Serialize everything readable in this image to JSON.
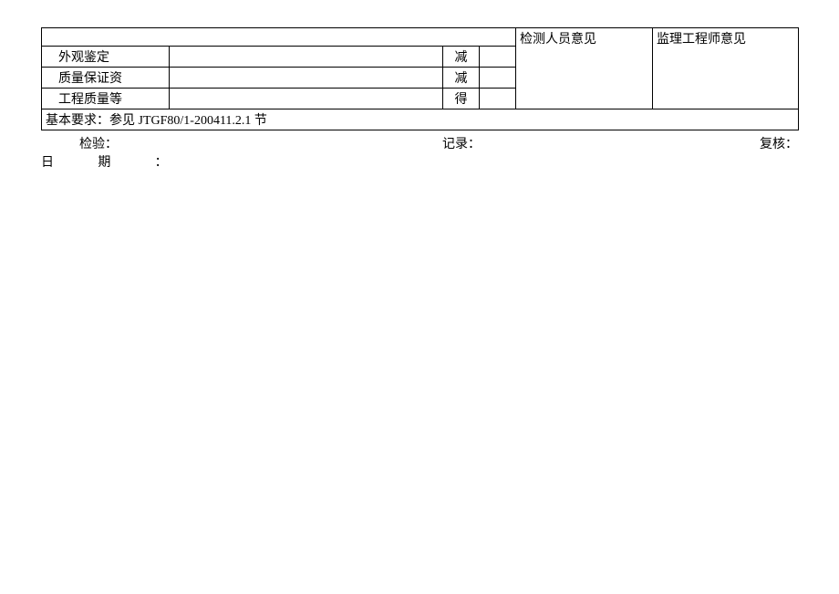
{
  "table": {
    "rows": [
      {
        "label": "外观鉴定",
        "short": "减"
      },
      {
        "label": "质量保证资",
        "short": "减"
      },
      {
        "label": "工程质量等",
        "short": "得"
      }
    ],
    "opinion1_header": "检测人员意见",
    "opinion2_header": "监理工程师意见",
    "basic_requirement": "基本要求：参见 JTGF80/1-200411.2.1 节"
  },
  "footer": {
    "inspect": "检验：",
    "record": "记录：",
    "review": "复核：",
    "date_prefix": "日",
    "date_suffix": "期",
    "colon": "："
  }
}
